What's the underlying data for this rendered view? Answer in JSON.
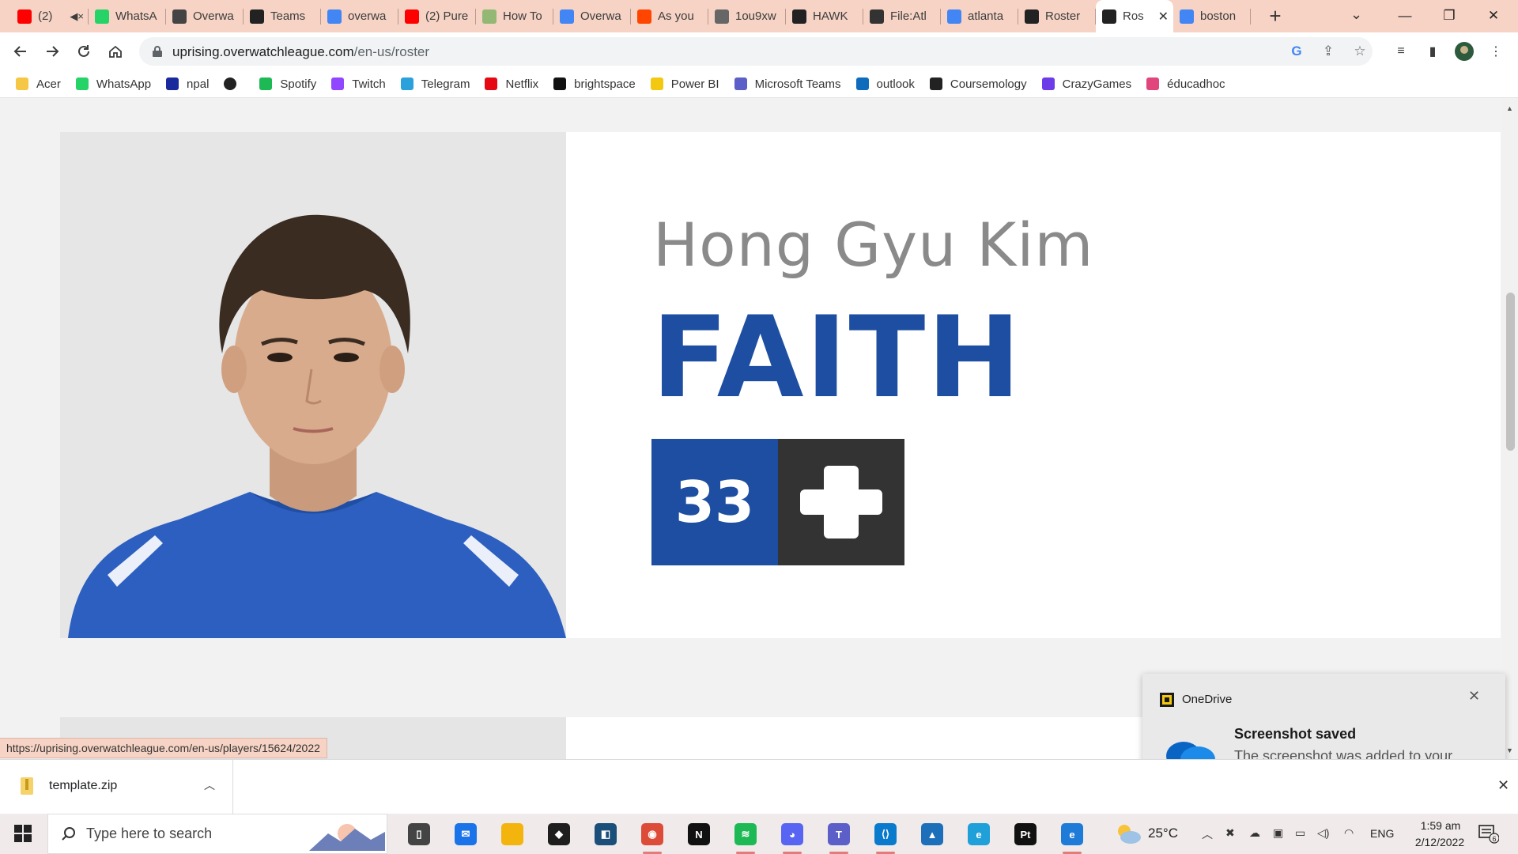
{
  "browser": {
    "tabs": [
      {
        "title": "(2)",
        "favicon": "youtube-icon",
        "color": "#ff0000",
        "muted": true
      },
      {
        "title": "WhatsA",
        "favicon": "whatsapp-icon",
        "color": "#25d366"
      },
      {
        "title": "Overwa",
        "favicon": "overwatch-icon",
        "color": "#444444"
      },
      {
        "title": "Teams",
        "favicon": "team-flag-icon",
        "color": "#222222"
      },
      {
        "title": "overwa",
        "favicon": "google-icon",
        "color": "#4285f4"
      },
      {
        "title": "(2) Pure",
        "favicon": "youtube-icon",
        "color": "#ff0000"
      },
      {
        "title": "How To",
        "favicon": "wikihow-icon",
        "color": "#93b874"
      },
      {
        "title": "Overwa",
        "favicon": "google-icon",
        "color": "#4285f4"
      },
      {
        "title": "As you",
        "favicon": "reddit-icon",
        "color": "#ff4500"
      },
      {
        "title": "1ou9xw",
        "favicon": "globe-icon",
        "color": "#666666"
      },
      {
        "title": "HAWK",
        "favicon": "team-flag-icon",
        "color": "#222222"
      },
      {
        "title": "File:Atl",
        "favicon": "fandom-icon",
        "color": "#333333"
      },
      {
        "title": "atlanta",
        "favicon": "google-icon",
        "color": "#4285f4"
      },
      {
        "title": "Roster",
        "favicon": "team-flag-icon",
        "color": "#222222"
      },
      {
        "title": "Ros",
        "favicon": "team-flag-icon",
        "color": "#222222",
        "active": true
      },
      {
        "title": "boston",
        "favicon": "google-icon",
        "color": "#4285f4"
      }
    ],
    "url_host": "uprising.overwatchleague.com",
    "url_path": "/en-us/roster",
    "bookmarks": [
      {
        "label": "Acer",
        "icon": "folder-icon",
        "color": "#f6c744"
      },
      {
        "label": "WhatsApp",
        "icon": "whatsapp-icon",
        "color": "#25d366"
      },
      {
        "label": "npal",
        "icon": "npal-icon",
        "color": "#1a2a9c"
      },
      {
        "label": "",
        "icon": "globe-icon",
        "color": "#222222"
      },
      {
        "label": "Spotify",
        "icon": "spotify-icon",
        "color": "#1db954"
      },
      {
        "label": "Twitch",
        "icon": "twitch-icon",
        "color": "#9146ff"
      },
      {
        "label": "Telegram",
        "icon": "telegram-icon",
        "color": "#2aa1da"
      },
      {
        "label": "Netflix",
        "icon": "netflix-icon",
        "color": "#e50914"
      },
      {
        "label": "brightspace",
        "icon": "np-icon",
        "color": "#111111"
      },
      {
        "label": "Power BI",
        "icon": "powerbi-icon",
        "color": "#f2c811"
      },
      {
        "label": "Microsoft Teams",
        "icon": "teams-icon",
        "color": "#5b5fc7"
      },
      {
        "label": "outlook",
        "icon": "outlook-icon",
        "color": "#0f6cbd"
      },
      {
        "label": "Coursemology",
        "icon": "coursemology-icon",
        "color": "#222222"
      },
      {
        "label": "CrazyGames",
        "icon": "crazygames-icon",
        "color": "#6c3ce9"
      },
      {
        "label": "éducadhoc",
        "icon": "educadhoc-icon",
        "color": "#e0457b"
      }
    ],
    "status_url": "https://uprising.overwatchleague.com/en-us/players/15624/2022"
  },
  "player": {
    "real_name": "Hong Gyu Kim",
    "handle": "FAITH",
    "number": "33",
    "role_icon": "support-plus-icon",
    "brand_color": "#1d4ea1",
    "role_bg": "#333333"
  },
  "toast": {
    "app": "OneDrive",
    "title": "Screenshot saved",
    "body": "The screenshot was added to your OneDrive."
  },
  "downloads": {
    "file": "template.zip"
  },
  "taskbar": {
    "search_placeholder": "Type here to search",
    "apps": [
      {
        "name": "task-view",
        "color": "#444444",
        "glyph": "▯"
      },
      {
        "name": "mail",
        "color": "#1a73e8",
        "glyph": "✉"
      },
      {
        "name": "file-explorer",
        "color": "#f3b40d",
        "glyph": ""
      },
      {
        "name": "dropbox",
        "color": "#1e1e1e",
        "glyph": "◆"
      },
      {
        "name": "app-blue",
        "color": "#1b4f7a",
        "glyph": "◧"
      },
      {
        "name": "chrome",
        "color": "#dd4b39",
        "glyph": "◉",
        "running": true
      },
      {
        "name": "netflix",
        "color": "#111111",
        "glyph": "N"
      },
      {
        "name": "spotify",
        "color": "#1db954",
        "glyph": "≋",
        "running": true
      },
      {
        "name": "discord",
        "color": "#5865f2",
        "glyph": "◕",
        "running": true
      },
      {
        "name": "teams",
        "color": "#5b5fc7",
        "glyph": "T",
        "running": true
      },
      {
        "name": "vscode",
        "color": "#0a7acc",
        "glyph": "⟨⟩",
        "running": true
      },
      {
        "name": "photos",
        "color": "#1c6fb8",
        "glyph": "▲"
      },
      {
        "name": "edge",
        "color": "#1fa0d8",
        "glyph": "e"
      },
      {
        "name": "pycharm",
        "color": "#111111",
        "glyph": "Pt"
      },
      {
        "name": "edge-dev",
        "color": "#1f7bd8",
        "glyph": "e",
        "running": true
      }
    ],
    "temperature": "25°C",
    "language": "ENG",
    "time": "1:59 am",
    "date": "2/12/2022",
    "notification_count": "6"
  }
}
